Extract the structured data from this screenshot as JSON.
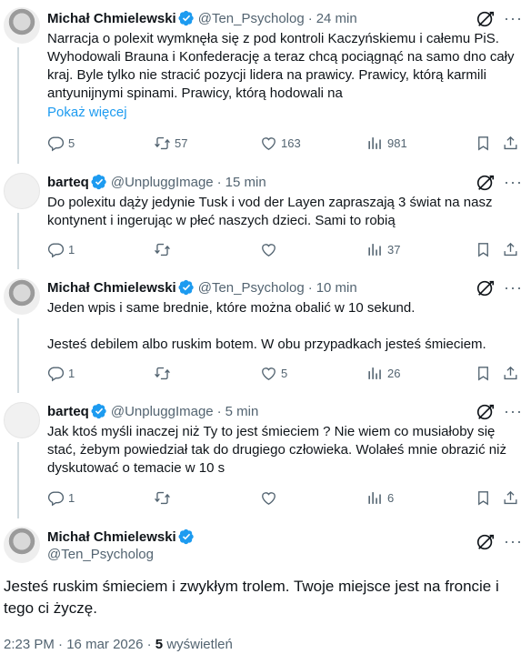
{
  "tweets": [
    {
      "name": "Michał Chmielewski",
      "handle": "@Ten_Psycholog",
      "time": "24 min",
      "text": [
        "Narracja o polexit wymknęła się z pod kontroli Kaczyńskiemu i całemu PiS. Wyhodowali Brauna i Konfederację a teraz chcą pociągnąć na samo dno cały kraj. Byle tylko nie stracić pozycji lidera na prawicy. Prawicy, którą karmili antyunijnymi spinami. Prawicy, którą hodowali na"
      ],
      "show_more": "Pokaż więcej",
      "replies": "5",
      "retweets": "57",
      "likes": "163",
      "views": "981"
    },
    {
      "name": "barteq",
      "handle": "@UnpluggImage",
      "time": "15 min",
      "text": [
        "Do polexitu dąży jedynie Tusk i vod der Layen zapraszają 3 świat na nasz kontynent i ingerując w płeć naszych dzieci. Sami to robią"
      ],
      "replies": "1",
      "retweets": "",
      "likes": "",
      "views": "37"
    },
    {
      "name": "Michał Chmielewski",
      "handle": "@Ten_Psycholog",
      "time": "10 min",
      "text": [
        "Jeden wpis i same brednie, które można obalić w 10 sekund.",
        "Jesteś debilem albo ruskim botem. W obu przypadkach jesteś śmieciem."
      ],
      "replies": "1",
      "retweets": "",
      "likes": "5",
      "views": "26"
    },
    {
      "name": "barteq",
      "handle": "@UnpluggImage",
      "time": "5 min",
      "text": [
        "Jak ktoś myśli inaczej niż Ty to jest śmieciem ? Nie wiem co musiałoby się stać, żebym powiedział tak do drugiego człowieka. Wolałeś mnie obrazić niż dyskutować o temacie w 10 s"
      ],
      "replies": "1",
      "retweets": "",
      "likes": "",
      "views": "6"
    }
  ],
  "main": {
    "name": "Michał Chmielewski",
    "handle": "@Ten_Psycholog",
    "text": "Jesteś ruskim śmieciem i zwykłym trolem. Twoje miejsce jest na froncie i tego ci życzę.",
    "time": "2:23 PM",
    "date": "16 mar 2026",
    "views_count": "5",
    "views_label": "wyświetleń"
  },
  "ui": {
    "separator": "·"
  },
  "colors": {
    "accent": "#1d9bf0",
    "muted": "#536471",
    "text": "#0f1419",
    "line": "#cfd9de"
  },
  "icons": [
    "verified-badge-icon",
    "grok-icon",
    "more-icon",
    "reply-icon",
    "retweet-icon",
    "like-icon",
    "views-icon",
    "bookmark-icon",
    "share-icon"
  ]
}
